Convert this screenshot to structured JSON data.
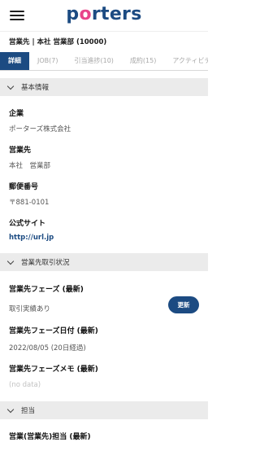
{
  "header": {
    "logo_part1": "p",
    "logo_o": "o",
    "logo_part2": "rters"
  },
  "breadcrumb": "営業先 | 本社 営業部 (10000)",
  "tabs": [
    {
      "label": "詳細",
      "active": true
    },
    {
      "label": "JOB(7)"
    },
    {
      "label": "引当進捗(10)"
    },
    {
      "label": "成約(15)"
    },
    {
      "label": "アクティビティ"
    }
  ],
  "sections": {
    "basic": {
      "title": "基本情報",
      "company_label": "企業",
      "company_value": "ポーターズ株式会社",
      "client_label": "営業先",
      "client_value": "本社　営業部",
      "postal_label": "郵便番号",
      "postal_value": "〒881-0101",
      "website_label": "公式サイト",
      "website_value": "http://url.jp"
    },
    "status": {
      "title": "営業先取引状況",
      "phase_label": "営業先フェーズ (最新)",
      "phase_value": "取引実績あり",
      "update_button": "更新",
      "phase_date_label": "営業先フェーズ日付 (最新)",
      "phase_date_value": "2022/08/05 (20日経過)",
      "phase_memo_label": "営業先フェーズメモ (最新)",
      "phase_memo_value": "(no data)"
    },
    "owner": {
      "title": "担当",
      "owner_label": "営業(営業先)担当 (最新)"
    }
  },
  "colors": {
    "primary": "#1c4b82",
    "accent": "#e8448a",
    "section_bg": "#ebebeb"
  }
}
